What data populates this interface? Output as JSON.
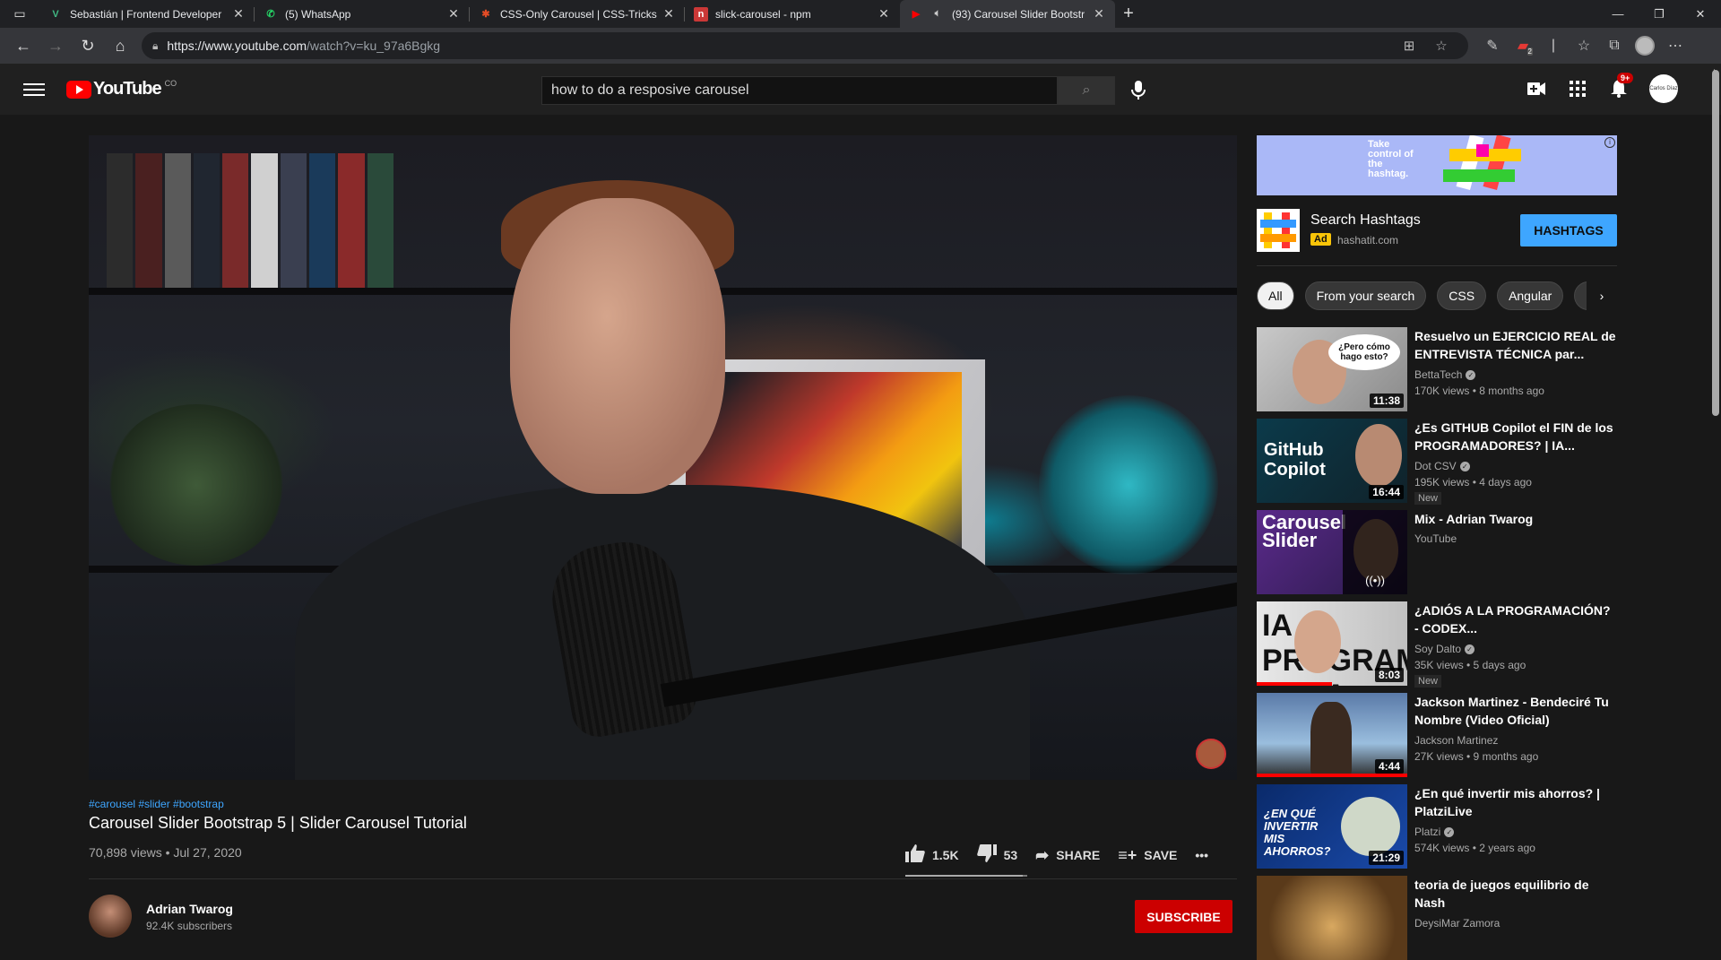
{
  "browser": {
    "tabs": [
      {
        "title": "Sebastián | Frontend Developer",
        "favicon": "V",
        "favicon_color": "#41b883"
      },
      {
        "title": "(5) WhatsApp",
        "favicon": "✆",
        "favicon_color": "#25d366"
      },
      {
        "title": "CSS-Only Carousel | CSS-Tricks",
        "favicon": "✱",
        "favicon_color": "#e34c26"
      },
      {
        "title": "slick-carousel - npm",
        "favicon": "n",
        "favicon_color": "#cb3837"
      },
      {
        "title": "(93) Carousel Slider Bootstr",
        "favicon": "▶",
        "favicon_color": "#ff0000"
      }
    ],
    "url_main": "https://www.youtube.com",
    "url_rest": "/watch?v=ku_97a6Bgkg"
  },
  "youtube": {
    "logo_text": "YouTube",
    "country": "CO",
    "search_query": "how to do a resposive carousel",
    "notifications": "9+",
    "profile_text": "Carlos Díaz"
  },
  "video": {
    "hashtags": "#carousel #slider #bootstrap",
    "title": "Carousel Slider Bootstrap 5 | Slider Carousel Tutorial",
    "meta": "70,898 views • Jul 27, 2020",
    "likes": "1.5K",
    "dislikes": "53",
    "like_ratio": 0.966,
    "share_label": "SHARE",
    "save_label": "SAVE",
    "channel": "Adrian Twarog",
    "subscribers": "92.4K subscribers",
    "subscribe_label": "SUBSCRIBE"
  },
  "ad": {
    "banner_text": "Take control of the hashtag.",
    "title": "Search Hashtags",
    "tag": "Ad",
    "domain": "hashatit.com",
    "cta": "HASHTAGS"
  },
  "chips": [
    "All",
    "From your search",
    "CSS",
    "Angular"
  ],
  "recommendations": [
    {
      "title": "Resuelvo un EJERCICIO REAL de ENTREVISTA TÉCNICA par...",
      "channel": "BettaTech",
      "verified": true,
      "meta": "170K views • 8 months ago",
      "duration": "11:38",
      "badge": "",
      "thumb_text": "¿Pero cómo hago esto?"
    },
    {
      "title": "¿Es GITHUB Copilot el FIN de los PROGRAMADORES? | IA...",
      "channel": "Dot CSV",
      "verified": true,
      "meta": "195K views • 4 days ago",
      "duration": "16:44",
      "badge": "New",
      "thumb_text": "GitHub Copilot"
    },
    {
      "title": "Mix - Adrian Twarog",
      "channel": "YouTube",
      "verified": false,
      "meta": "",
      "duration": "",
      "badge": "",
      "thumb_text": "Carousel Slider"
    },
    {
      "title": "¿ADIÓS A LA PROGRAMACIÓN? - CODEX...",
      "channel": "Soy Dalto",
      "verified": true,
      "meta": "35K views • 5 days ago",
      "duration": "8:03",
      "badge": "New",
      "thumb_text": "IA PROGRAMA SOLA"
    },
    {
      "title": "Jackson Martinez - Bendeciré Tu Nombre (Video Oficial)",
      "channel": "Jackson Martinez",
      "verified": false,
      "meta": "27K views • 9 months ago",
      "duration": "4:44",
      "badge": "",
      "thumb_text": ""
    },
    {
      "title": "¿En qué invertir mis ahorros? | PlatziLive",
      "channel": "Platzi",
      "verified": true,
      "meta": "574K views • 2 years ago",
      "duration": "21:29",
      "badge": "",
      "thumb_text": "¿EN QUÉ INVERTIR MIS AHORROS?"
    },
    {
      "title": "teoria de juegos equilibrio de Nash",
      "channel": "DeysiMar Zamora",
      "verified": false,
      "meta": "",
      "duration": "",
      "badge": "",
      "thumb_text": ""
    }
  ]
}
